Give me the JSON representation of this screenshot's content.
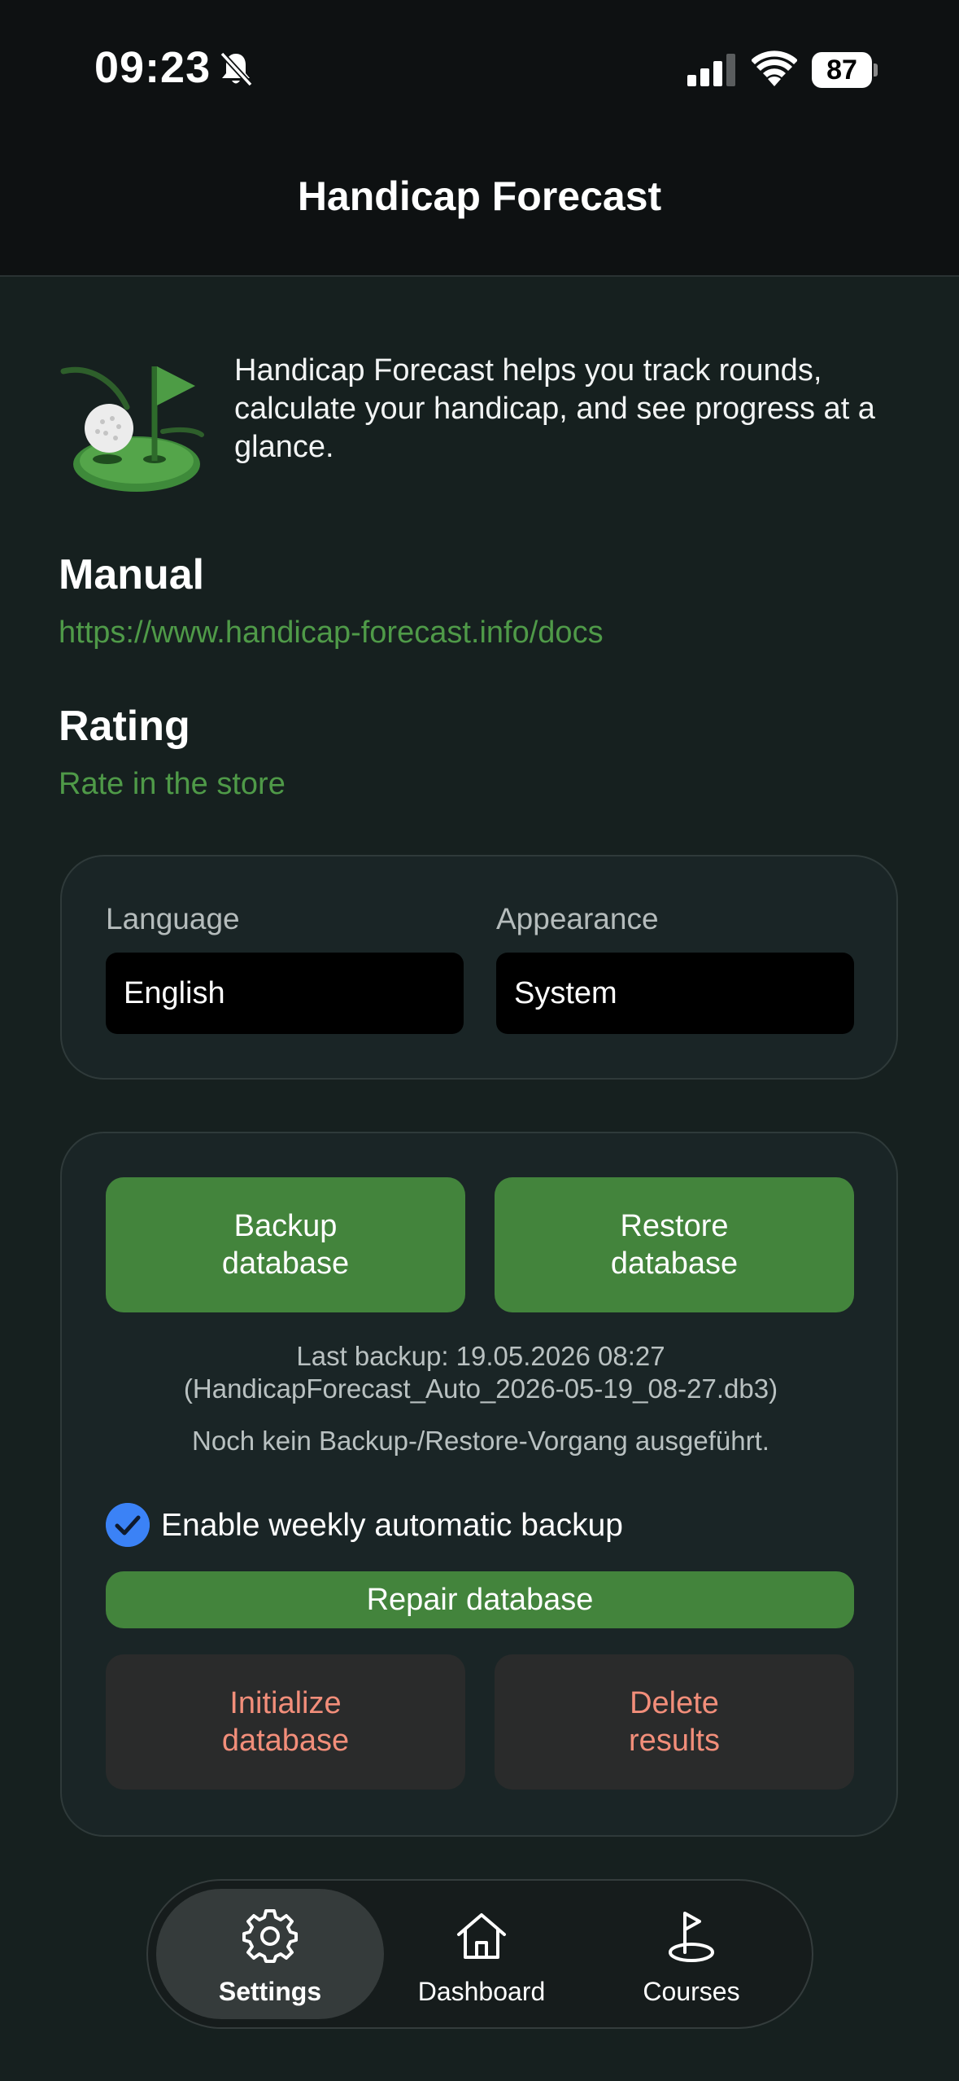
{
  "status": {
    "time": "09:23",
    "battery": "87"
  },
  "header": {
    "title": "Handicap Forecast"
  },
  "intro": {
    "text": "Handicap Forecast helps you track rounds, calculate your handicap, and see progress at a glance."
  },
  "manual": {
    "title": "Manual",
    "link": "https://www.handicap-forecast.info/docs"
  },
  "rating": {
    "title": "Rating",
    "link": "Rate in the store"
  },
  "preferences": {
    "language_label": "Language",
    "language_value": "English",
    "appearance_label": "Appearance",
    "appearance_value": "System"
  },
  "database": {
    "backup_label_1": "Backup",
    "backup_label_2": "database",
    "restore_label_1": "Restore",
    "restore_label_2": "database",
    "last_backup": "Last backup: 19.05.2026 08:27",
    "last_backup_file": "(HandicapForecast_Auto_2026-05-19_08-27.db3)",
    "status_text": "Noch kein Backup-/Restore-Vorgang ausgeführt.",
    "weekly_backup_label": "Enable weekly automatic backup",
    "weekly_backup_enabled": true,
    "repair_label": "Repair database",
    "initialize_label_1": "Initialize",
    "initialize_label_2": "database",
    "delete_label_1": "Delete",
    "delete_label_2": "results"
  },
  "tabs": [
    {
      "label": "Settings",
      "icon": "gear-icon",
      "active": true
    },
    {
      "label": "Dashboard",
      "icon": "home-icon",
      "active": false
    },
    {
      "label": "Courses",
      "icon": "flag-icon",
      "active": false
    }
  ],
  "colors": {
    "background": "#16201f",
    "accent_green": "#43843c",
    "link_green": "#4f9a48",
    "danger_text": "#f28e7a",
    "checkbox_blue": "#3b82f6"
  }
}
